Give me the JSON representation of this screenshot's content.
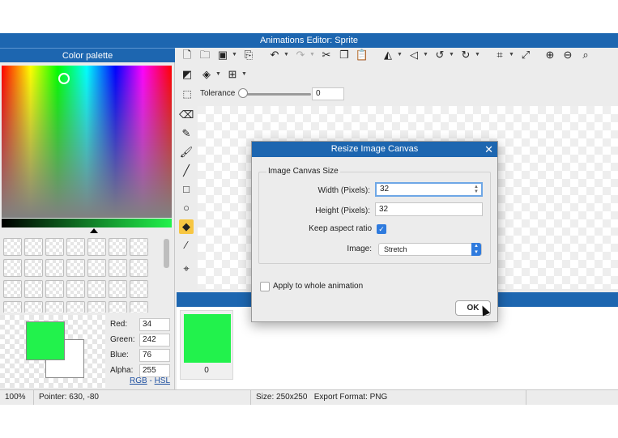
{
  "window": {
    "title": "Animations Editor: Sprite"
  },
  "palette": {
    "title": "Color palette",
    "primary_color": "#22f24c",
    "secondary_color": "#ffffff",
    "channels": [
      {
        "label": "Red:",
        "value": "34"
      },
      {
        "label": "Green:",
        "value": "242"
      },
      {
        "label": "Blue:",
        "value": "76"
      },
      {
        "label": "Alpha:",
        "value": "255"
      }
    ],
    "mode_rgb": "RGB",
    "mode_sep": "-",
    "mode_hsl": "HSL"
  },
  "toolbar": {
    "row1_icons": [
      "new-file-icon",
      "open-folder-icon",
      "save-icon",
      "export-icon",
      "undo-icon",
      "redo-icon",
      "cut-icon",
      "copy-icon",
      "paste-icon",
      "flip-horizontal-icon",
      "flip-vertical-icon",
      "rotate-left-icon",
      "rotate-right-icon",
      "crop-icon",
      "resize-icon",
      "zoom-in-icon",
      "zoom-out-icon",
      "zoom-fit-icon"
    ],
    "row2_icons": [
      "invert-icon",
      "layers-icon",
      "grid-icon"
    ],
    "tolerance_label": "Tolerance",
    "tolerance_value": "0",
    "tolerance_level": 0
  },
  "tools": [
    "eraser-icon",
    "pencil-icon",
    "brush-icon",
    "line-icon",
    "rectangle-icon",
    "ellipse-icon",
    "fill-bucket-icon",
    "eyedropper-icon",
    "center-point-icon"
  ],
  "frames": [
    {
      "label": "0",
      "color": "#22f24c"
    }
  ],
  "status": {
    "zoom": "100%",
    "pointer": "Pointer: 630, -80",
    "size": "Size: 250x250",
    "export_format": "Export Format: PNG"
  },
  "dialog": {
    "title": "Resize Image Canvas",
    "close": "✕",
    "group_label": "Image Canvas Size",
    "width_label": "Width (Pixels):",
    "width_value": "32",
    "height_label": "Height (Pixels):",
    "height_value": "32",
    "keep_aspect_label": "Keep aspect ratio",
    "keep_aspect_checked": true,
    "image_label": "Image:",
    "image_option": "Stretch",
    "apply_all_label": "Apply to whole animation",
    "apply_all_checked": false,
    "ok_label": "OK"
  }
}
